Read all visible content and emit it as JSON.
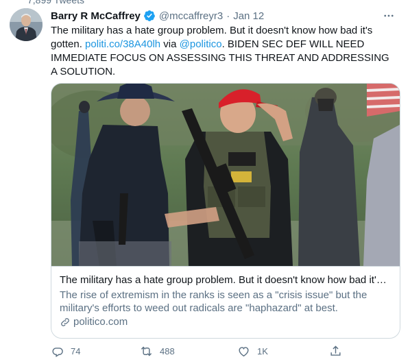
{
  "tweet": {
    "author_name": "Barry R McCaffrey",
    "handle": "@mccaffreyr3",
    "separator": "·",
    "date": "Jan 12",
    "text_part1": "The military has a hate group problem. But it doesn't know how bad it's gotten. ",
    "link1": "politi.co/38A40lh",
    "text_via": " via ",
    "mention": "@politico",
    "text_part2": ". BIDEN SEC DEF WILL NEED IMMEDIATE FOCUS ON ASSESSING THIS THREAT AND ADDRESSING A SOLUTION."
  },
  "card": {
    "title": "The military has a hate group problem. But it doesn't know how bad it's ...",
    "description": "The rise of extremism in the ranks is seen as a \"crisis issue\" but the military's efforts to weed out radicals are \"haphazard\" at best.",
    "domain": "politico.com"
  },
  "actions": {
    "reply_count": "74",
    "retweet_count": "488",
    "like_count": "1K"
  },
  "icons": [
    "verified-icon",
    "more-icon",
    "link-icon",
    "reply-icon",
    "retweet-icon",
    "like-icon",
    "share-icon"
  ],
  "colors": {
    "link": "#1b95e0",
    "verified": "#1da1f2",
    "muted": "#5b7083"
  }
}
